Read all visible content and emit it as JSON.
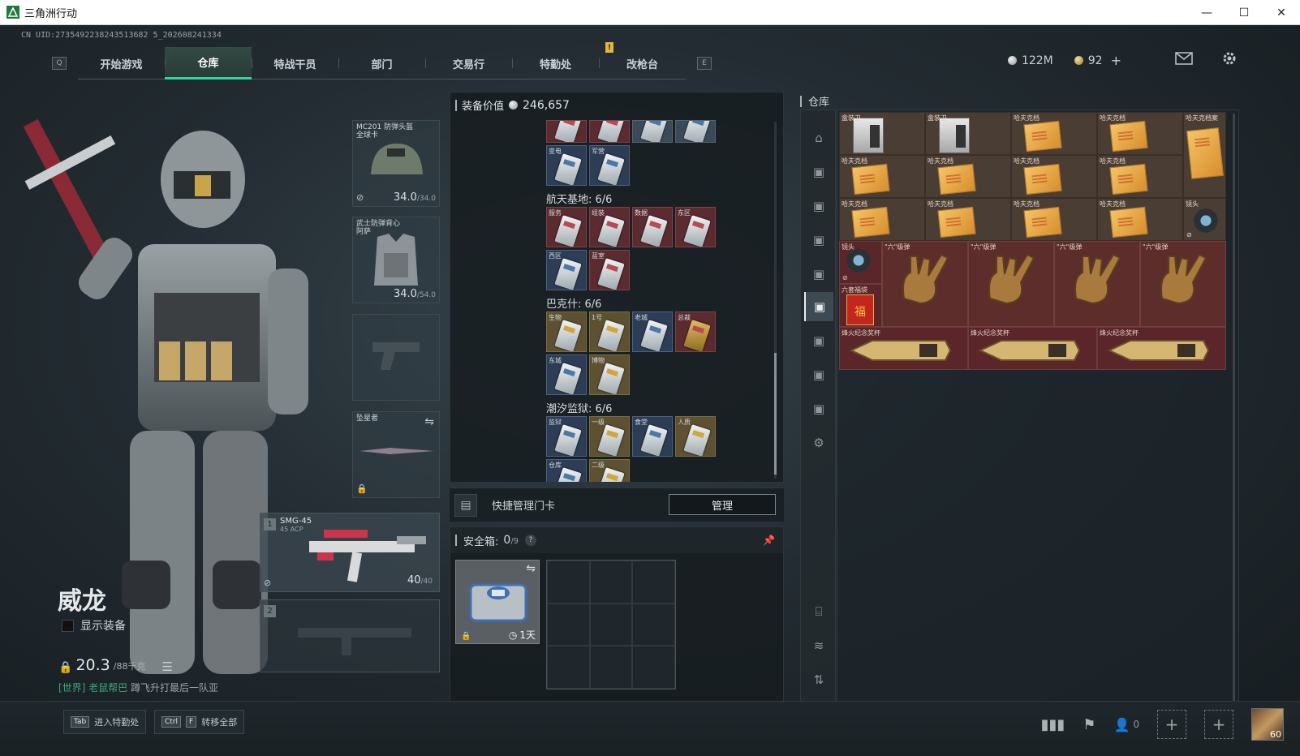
{
  "window": {
    "title": "三角洲行动",
    "minimize": "—",
    "maximize": "☐",
    "close": "✕"
  },
  "uid": "CN UID:2735492238243513682 5_202608241334",
  "nav": {
    "key_left": "Q",
    "key_right": "E",
    "tabs": [
      "开始游戏",
      "仓库",
      "特战干员",
      "部门",
      "交易行",
      "特勤处",
      "改枪台"
    ],
    "active_tab": "仓库",
    "notify": "!"
  },
  "currency": {
    "silver": "122M",
    "gold": "92",
    "plus": "+"
  },
  "operator": {
    "name": "威龙",
    "show_equipment": "显示装备",
    "weight_value": "20.3",
    "weight_max": "/88千克",
    "chat_channel": "[世界]",
    "chat_user": "老鼠帮巴",
    "chat_text": "蹲飞升打最后一队亚"
  },
  "gear": {
    "helmet_label": "MC201 防弹头盔",
    "helmet_sub": "全球卡",
    "helmet_value": "34.0",
    "helmet_max": "/34.0",
    "armor_label": "武士防弹背心",
    "armor_sub": "阿萨",
    "armor_value": "34.0",
    "armor_max": "/54.0",
    "melee_label": "坠星者"
  },
  "weapons": [
    {
      "num": "1",
      "name": "SMG-45",
      "sub": "45 ACP",
      "ammo": "40",
      "ammo_max": "/40"
    },
    {
      "num": "2",
      "name": "",
      "sub": "",
      "ammo": "",
      "ammo_max": ""
    }
  ],
  "equipment_value": {
    "label": "装备价值",
    "value": "246,657"
  },
  "keycards": {
    "top_row_labels": [
      "",
      "",
      "",
      ""
    ],
    "prev_row": [
      "变电",
      "军营"
    ],
    "sections": [
      {
        "title": "航天基地: 6/6",
        "cards": [
          "服务",
          "组装",
          "数据",
          "东区",
          "西区",
          "蓝室"
        ]
      },
      {
        "title": "巴克什: 6/6",
        "cards": [
          "生物",
          "1号",
          "老城",
          "总裁",
          "东城",
          "博物"
        ]
      },
      {
        "title": "潮汐监狱: 6/6",
        "cards": [
          "监狱",
          "一级",
          "食堂",
          "人质",
          "仓库",
          "二级"
        ]
      }
    ]
  },
  "quick_manage": {
    "label": "快捷管理门卡",
    "button": "管理"
  },
  "safebox": {
    "label": "安全箱:",
    "count": "0",
    "capacity": "/9",
    "help": "?",
    "days": "1天"
  },
  "warehouse": {
    "title": "仓库",
    "row1": [
      "盒装卫",
      "盒装卫",
      "哈夫克档",
      "哈夫克档",
      "哈夫克档案"
    ],
    "row2": [
      "哈夫克档",
      "哈夫克档",
      "哈夫克档",
      "哈夫克档"
    ],
    "row3": [
      "哈夫克档",
      "哈夫克档",
      "哈夫克档",
      "哈夫克档",
      "镜头"
    ],
    "row4": [
      "镜头",
      "\"六\"级弹",
      "\"六\"级弹",
      "\"六\"级弹",
      "\"六\"级弹"
    ],
    "row4_small": "六套福袋",
    "row6": [
      "烽火纪念奖杯",
      "烽火纪念奖杯",
      "烽火纪念奖杯"
    ]
  },
  "bottom": {
    "hint1_key": "Tab",
    "hint1_text": "进入特勤处",
    "hint2_key1": "Ctrl",
    "hint2_key2": "F",
    "hint2_text": "转移全部",
    "friends_count": "0",
    "avatar_level": "60"
  },
  "colors": {
    "accent": "#2fd7a0",
    "red_cell": "#5b262a",
    "doc_cell": "#4a3d33"
  }
}
